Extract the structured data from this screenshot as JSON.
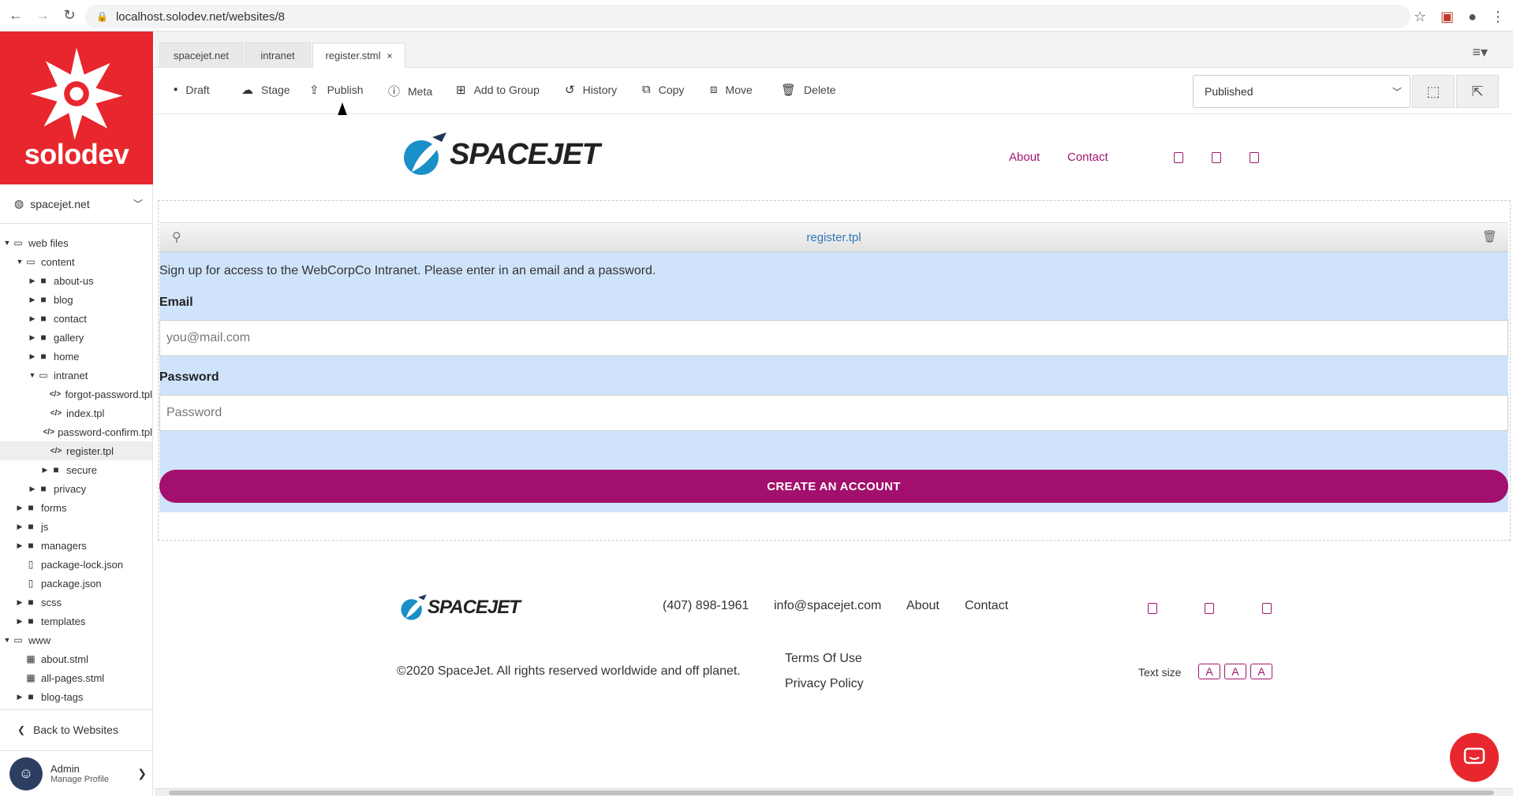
{
  "browser": {
    "url": "localhost.solodev.net/websites/8"
  },
  "sidebar": {
    "logo_text": "solodev",
    "site_name": "spacejet.net",
    "tree": [
      {
        "label": "web files",
        "depth": 0,
        "type": "folder-open",
        "caret": "down"
      },
      {
        "label": "content",
        "depth": 1,
        "type": "folder-open",
        "caret": "down"
      },
      {
        "label": "about-us",
        "depth": 2,
        "type": "folder",
        "caret": "right"
      },
      {
        "label": "blog",
        "depth": 2,
        "type": "folder",
        "caret": "right"
      },
      {
        "label": "contact",
        "depth": 2,
        "type": "folder",
        "caret": "right"
      },
      {
        "label": "gallery",
        "depth": 2,
        "type": "folder",
        "caret": "right"
      },
      {
        "label": "home",
        "depth": 2,
        "type": "folder",
        "caret": "right"
      },
      {
        "label": "intranet",
        "depth": 2,
        "type": "folder-open",
        "caret": "down"
      },
      {
        "label": "forgot-password.tpl",
        "depth": 3,
        "type": "code",
        "caret": ""
      },
      {
        "label": "index.tpl",
        "depth": 3,
        "type": "code",
        "caret": ""
      },
      {
        "label": "password-confirm.tpl",
        "depth": 3,
        "type": "code",
        "caret": ""
      },
      {
        "label": "register.tpl",
        "depth": 3,
        "type": "code",
        "caret": "",
        "selected": true
      },
      {
        "label": "secure",
        "depth": 3,
        "type": "folder",
        "caret": "right"
      },
      {
        "label": "privacy",
        "depth": 2,
        "type": "folder",
        "caret": "right"
      },
      {
        "label": "forms",
        "depth": 1,
        "type": "folder",
        "caret": "right"
      },
      {
        "label": "js",
        "depth": 1,
        "type": "folder",
        "caret": "right"
      },
      {
        "label": "managers",
        "depth": 1,
        "type": "folder",
        "caret": "right"
      },
      {
        "label": "package-lock.json",
        "depth": 1,
        "type": "file",
        "caret": ""
      },
      {
        "label": "package.json",
        "depth": 1,
        "type": "file",
        "caret": ""
      },
      {
        "label": "scss",
        "depth": 1,
        "type": "folder",
        "caret": "right"
      },
      {
        "label": "templates",
        "depth": 1,
        "type": "folder",
        "caret": "right"
      },
      {
        "label": "www",
        "depth": 0,
        "type": "folder-open",
        "caret": "down"
      },
      {
        "label": "about.stml",
        "depth": 1,
        "type": "page",
        "caret": ""
      },
      {
        "label": "all-pages.stml",
        "depth": 1,
        "type": "page",
        "caret": ""
      },
      {
        "label": "blog-tags",
        "depth": 1,
        "type": "folder",
        "caret": "right"
      }
    ],
    "back_label": "Back to Websites",
    "profile_name": "Admin",
    "profile_sub": "Manage Profile"
  },
  "tabs": [
    {
      "label": "spacejet.net"
    },
    {
      "label": "intranet"
    },
    {
      "label": "register.stml",
      "close": "×"
    }
  ],
  "toolbar": {
    "draft": "Draft",
    "stage": "Stage",
    "publish": "Publish",
    "meta": "Meta",
    "add_to_group": "Add to Group",
    "history": "History",
    "copy": "Copy",
    "move": "Move",
    "delete": "Delete",
    "status": "Published"
  },
  "site": {
    "brand": "SPACEJET",
    "nav_about": "About",
    "nav_contact": "Contact",
    "template_name": "register.tpl",
    "intro": "Sign up for access to the WebCorpCo Intranet. Please enter in an email and a password.",
    "email_label": "Email",
    "email_placeholder": "you@mail.com",
    "password_label": "Password",
    "password_placeholder": "Password",
    "cta": "CREATE AN ACCOUNT"
  },
  "footer": {
    "phone": "(407) 898-1961",
    "email": "info@spacejet.com",
    "about": "About",
    "contact": "Contact",
    "copyright": "©2020 SpaceJet. All rights reserved worldwide and off planet.",
    "terms": "Terms Of Use",
    "privacy": "Privacy Policy",
    "text_size_label": "Text size",
    "text_size_options": [
      "A",
      "A",
      "A"
    ]
  },
  "colors": {
    "brand_red": "#e8262d",
    "accent_magenta": "#a30f6c",
    "form_bg": "#cfe4fb",
    "template_link": "#3179b7"
  }
}
